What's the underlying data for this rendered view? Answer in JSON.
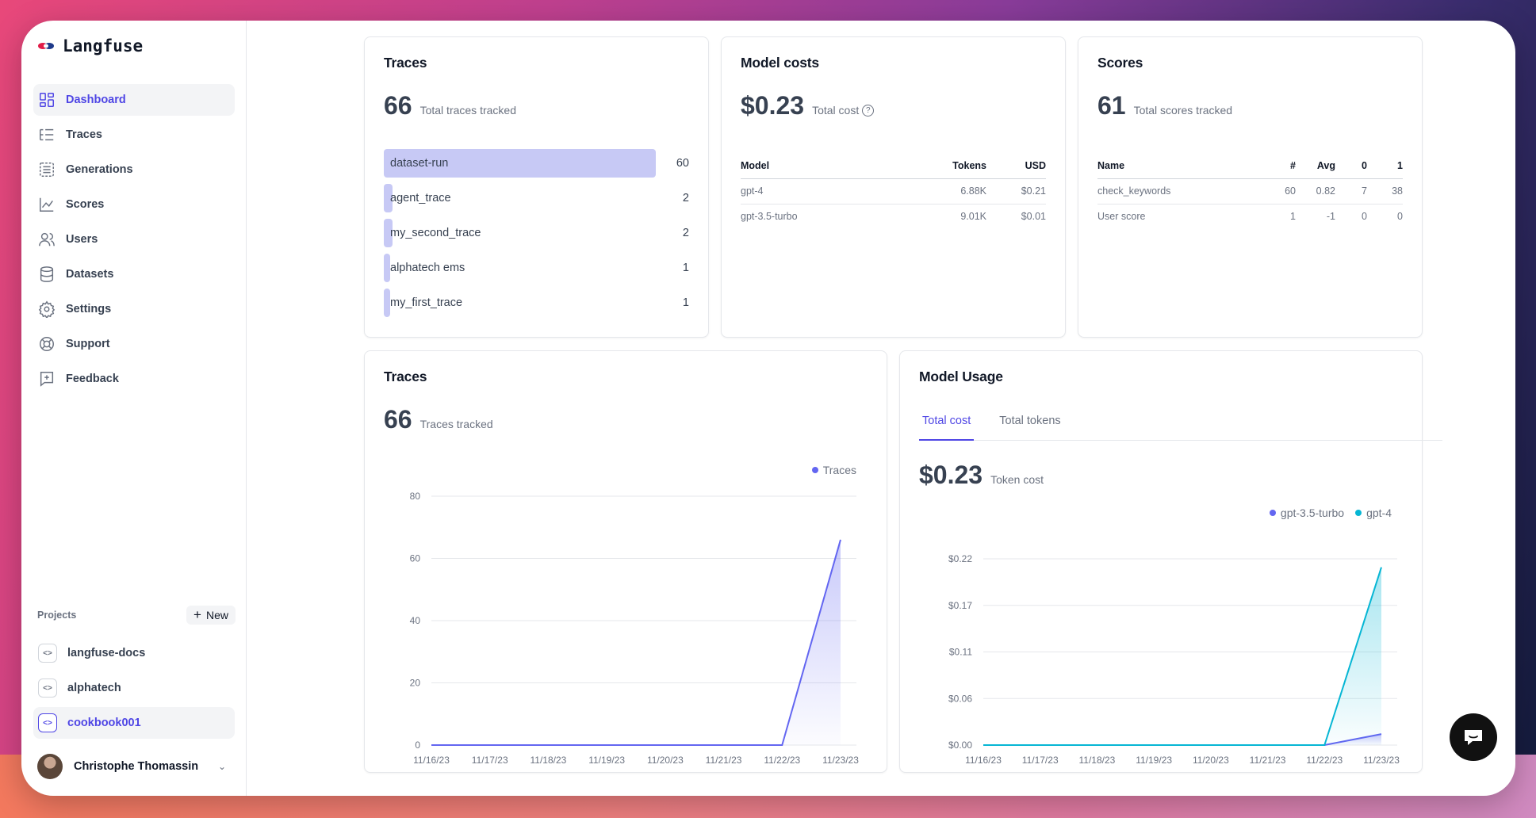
{
  "app": {
    "name": "Langfuse"
  },
  "nav": [
    {
      "label": "Dashboard",
      "icon": "dashboard-icon",
      "active": true
    },
    {
      "label": "Traces",
      "icon": "traces-icon",
      "active": false
    },
    {
      "label": "Generations",
      "icon": "generations-icon",
      "active": false
    },
    {
      "label": "Scores",
      "icon": "scores-icon",
      "active": false
    },
    {
      "label": "Users",
      "icon": "users-icon",
      "active": false
    },
    {
      "label": "Datasets",
      "icon": "database-icon",
      "active": false
    },
    {
      "label": "Settings",
      "icon": "gear-icon",
      "active": false
    },
    {
      "label": "Support",
      "icon": "lifebuoy-icon",
      "active": false
    },
    {
      "label": "Feedback",
      "icon": "feedback-icon",
      "active": false
    }
  ],
  "projects": {
    "label": "Projects",
    "new_label": "New",
    "items": [
      {
        "label": "langfuse-docs",
        "active": false
      },
      {
        "label": "alphatech",
        "active": false
      },
      {
        "label": "cookbook001",
        "active": true
      }
    ]
  },
  "user": {
    "name": "Christophe Thomassin"
  },
  "traces_card": {
    "title": "Traces",
    "total": "66",
    "total_label": "Total traces tracked",
    "rows": [
      {
        "name": "dataset-run",
        "value": 60
      },
      {
        "name": "agent_trace",
        "value": 2
      },
      {
        "name": "my_second_trace",
        "value": 2
      },
      {
        "name": "alphatech ems",
        "value": 1
      },
      {
        "name": "my_first_trace",
        "value": 1
      }
    ]
  },
  "costs_card": {
    "title": "Model costs",
    "total": "$0.23",
    "total_label": "Total cost",
    "headers": [
      "Model",
      "Tokens",
      "USD"
    ],
    "rows": [
      [
        "gpt-4",
        "6.88K",
        "$0.21"
      ],
      [
        "gpt-3.5-turbo",
        "9.01K",
        "$0.01"
      ]
    ]
  },
  "scores_card": {
    "title": "Scores",
    "total": "61",
    "total_label": "Total scores tracked",
    "headers": [
      "Name",
      "#",
      "Avg",
      "0",
      "1"
    ],
    "rows": [
      [
        "check_keywords",
        "60",
        "0.82",
        "7",
        "38"
      ],
      [
        "User score",
        "1",
        "-1",
        "0",
        "0"
      ]
    ]
  },
  "traces_chart_card": {
    "title": "Traces",
    "total": "66",
    "total_label": "Traces tracked"
  },
  "usage_card": {
    "title": "Model Usage",
    "tabs": [
      "Total cost",
      "Total tokens"
    ],
    "active_tab": 0,
    "total": "$0.23",
    "total_label": "Token cost"
  },
  "chart_data": [
    {
      "type": "area",
      "categories": [
        "11/16/23",
        "11/17/23",
        "11/18/23",
        "11/19/23",
        "11/20/23",
        "11/21/23",
        "11/22/23",
        "11/23/23"
      ],
      "series": [
        {
          "name": "Traces",
          "values": [
            0,
            0,
            0,
            0,
            0,
            0,
            0,
            66
          ],
          "color": "#6366f1"
        }
      ],
      "yticks": [
        "0",
        "20",
        "40",
        "60",
        "80"
      ],
      "ylim": [
        0,
        80
      ],
      "legend": "top-right",
      "grid": true
    },
    {
      "type": "area",
      "categories": [
        "11/16/23",
        "11/17/23",
        "11/18/23",
        "11/19/23",
        "11/20/23",
        "11/21/23",
        "11/22/23",
        "11/23/23"
      ],
      "series": [
        {
          "name": "gpt-3.5-turbo",
          "values": [
            0,
            0,
            0,
            0,
            0,
            0,
            0,
            0.013
          ],
          "color": "#6366f1"
        },
        {
          "name": "gpt-4",
          "values": [
            0,
            0,
            0,
            0,
            0,
            0,
            0,
            0.21
          ],
          "color": "#06b6d4"
        }
      ],
      "yticks": [
        "$0.00",
        "$0.06",
        "$0.11",
        "$0.17",
        "$0.22"
      ],
      "ylim": [
        0,
        0.22
      ],
      "legend": "top-right",
      "grid": true
    }
  ]
}
